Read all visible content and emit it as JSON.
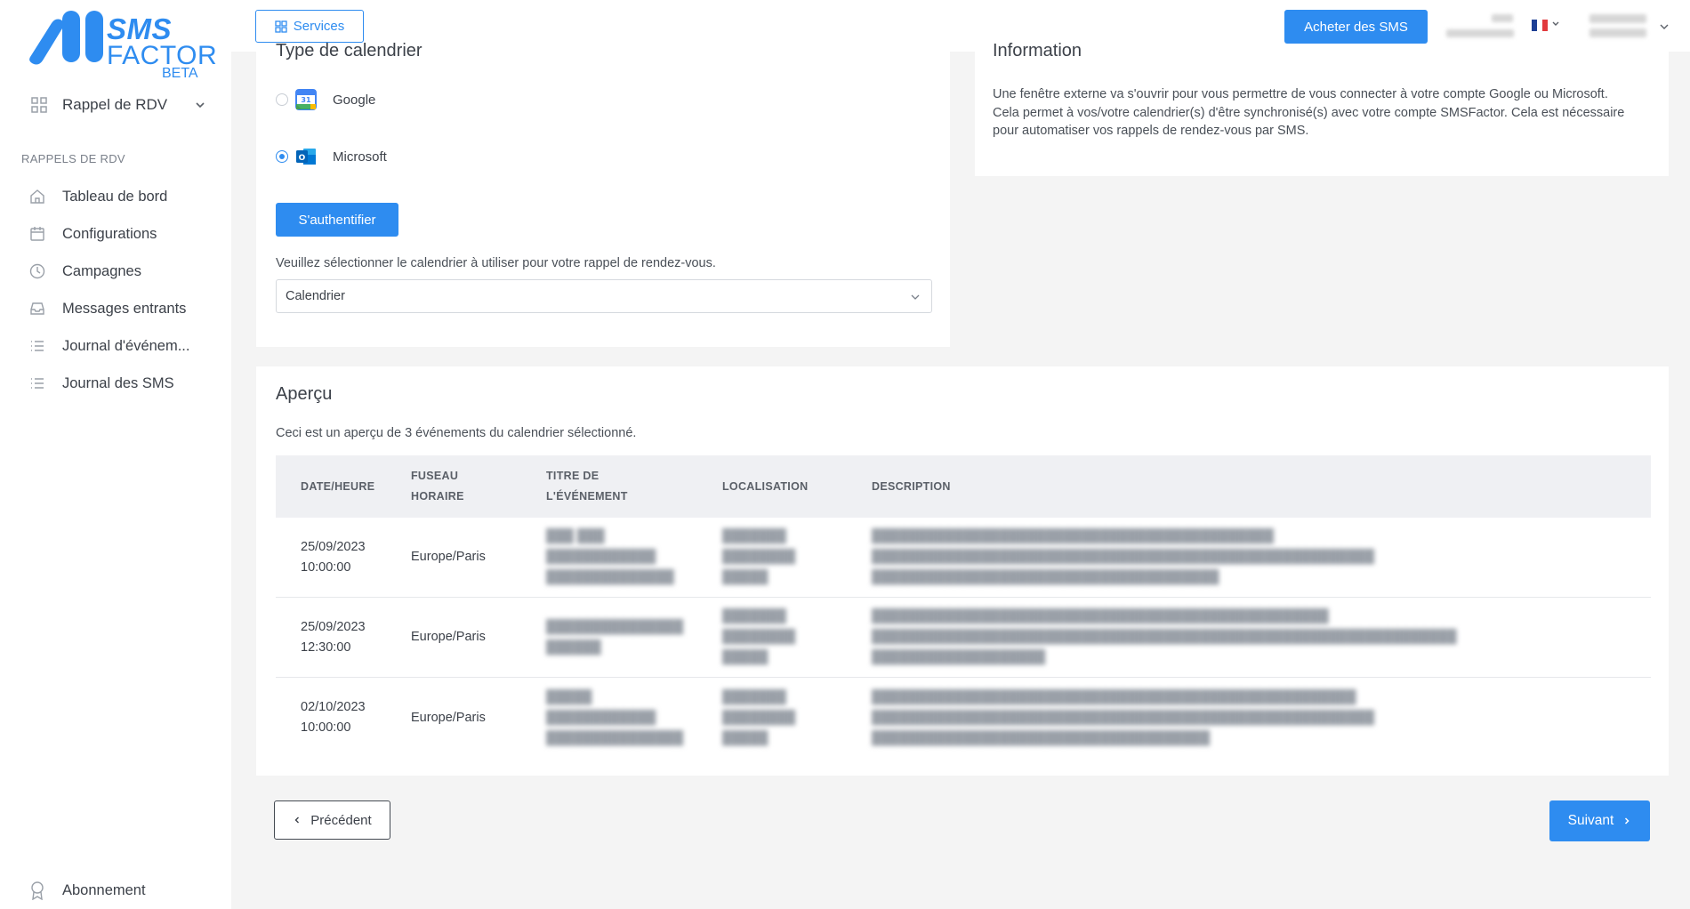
{
  "brand": {
    "sms": "SMS",
    "factor": "FACTOR",
    "beta": "BETA"
  },
  "sidebar": {
    "module": "Rappel de RDV",
    "section_title": "RAPPELS DE RDV",
    "items": [
      {
        "label": "Tableau de bord",
        "icon": "home-icon"
      },
      {
        "label": "Configurations",
        "icon": "calendar-icon"
      },
      {
        "label": "Campagnes",
        "icon": "clock-icon"
      },
      {
        "label": "Messages entrants",
        "icon": "inbox-icon"
      },
      {
        "label": "Journal d'événem...",
        "icon": "list-icon"
      },
      {
        "label": "Journal des SMS",
        "icon": "list-icon"
      }
    ],
    "bottom_item": {
      "label": "Abonnement",
      "icon": "award-icon"
    }
  },
  "topbar": {
    "services_label": "Services",
    "buy_label": "Acheter des SMS",
    "language": "fr"
  },
  "calendar_type": {
    "title": "Type de calendrier",
    "options": [
      {
        "label": "Google",
        "selected": false,
        "icon": "google-calendar-icon"
      },
      {
        "label": "Microsoft",
        "selected": true,
        "icon": "outlook-icon"
      }
    ],
    "auth_label": "S'authentifier",
    "hint": "Veuillez sélectionner le calendrier à utiliser pour votre rappel de rendez-vous.",
    "select_value": "Calendrier"
  },
  "information": {
    "title": "Information",
    "line1": "Une fenêtre externe va s'ouvrir pour vous permettre de vous connecter à votre compte Google ou Microsoft.",
    "line2": "Cela permet à vos/votre calendrier(s) d'être synchronisé(s) avec votre compte SMSFactor. Cela est nécessaire pour automatiser vos rappels de rendez-vous par SMS."
  },
  "preview": {
    "title": "Aperçu",
    "subtitle": "Ceci est un aperçu de 3 événements du calendrier sélectionné.",
    "columns": {
      "date": "DATE/HEURE",
      "tz_1": "FUSEAU",
      "tz_2": "HORAIRE",
      "title_1": "TITRE DE",
      "title_2": "L'ÉVÉNEMENT",
      "location": "LOCALISATION",
      "description": "DESCRIPTION"
    },
    "rows": [
      {
        "date": "25/09/2023",
        "time": "10:00:00",
        "timezone": "Europe/Paris"
      },
      {
        "date": "25/09/2023",
        "time": "12:30:00",
        "timezone": "Europe/Paris"
      },
      {
        "date": "02/10/2023",
        "time": "10:00:00",
        "timezone": "Europe/Paris"
      }
    ]
  },
  "footer": {
    "prev_label": "Précédent",
    "next_label": "Suivant"
  },
  "colors": {
    "accent": "#2e8cf0",
    "background": "#f4f4f4",
    "card": "#ffffff"
  }
}
